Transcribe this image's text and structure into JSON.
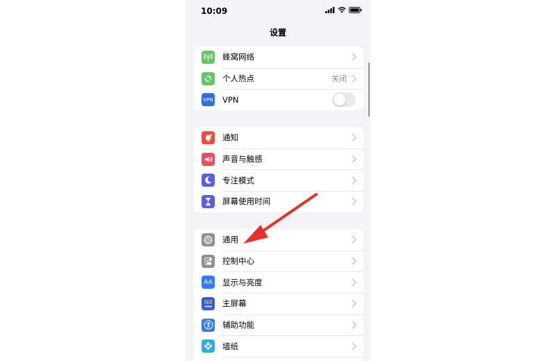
{
  "status_bar": {
    "time": "10:09"
  },
  "nav": {
    "title": "设置"
  },
  "groups": [
    {
      "items": [
        {
          "label": "蜂窝网络",
          "icon": "antenna-icon",
          "color": "#65c466",
          "accessory": "chevron"
        },
        {
          "label": "个人热点",
          "icon": "hotspot-link-icon",
          "color": "#65c466",
          "value": "关闭",
          "accessory": "chevron"
        },
        {
          "label": "VPN",
          "icon": "vpn-icon",
          "icon_text": "VPN",
          "color": "#2f6fe0",
          "accessory": "toggle",
          "toggle_on": false
        }
      ]
    },
    {
      "items": [
        {
          "label": "通知",
          "icon": "notification-bell-icon",
          "color": "#eb4d3d",
          "accessory": "chevron"
        },
        {
          "label": "声音与触感",
          "icon": "speaker-icon",
          "color": "#eb4d62",
          "accessory": "chevron"
        },
        {
          "label": "专注模式",
          "icon": "moon-icon",
          "color": "#5e5ce6",
          "accessory": "chevron"
        },
        {
          "label": "屏幕使用时间",
          "icon": "hourglass-icon",
          "color": "#5e5ce6",
          "accessory": "chevron"
        }
      ]
    },
    {
      "items": [
        {
          "label": "通用",
          "icon": "gear-icon",
          "color": "#8e8e93",
          "accessory": "chevron"
        },
        {
          "label": "控制中心",
          "icon": "switches-icon",
          "color": "#8e8e93",
          "accessory": "chevron"
        },
        {
          "label": "显示与亮度",
          "icon": "text-size-icon",
          "icon_text": "AA",
          "color": "#2f7cf6",
          "accessory": "chevron"
        },
        {
          "label": "主屏幕",
          "icon": "home-screen-grid-icon",
          "color": "#3a5bd1",
          "accessory": "chevron"
        },
        {
          "label": "辅助功能",
          "icon": "accessibility-icon",
          "color": "#2f7cf6",
          "accessory": "chevron"
        },
        {
          "label": "墙纸",
          "icon": "flower-icon",
          "color": "#35aadc",
          "accessory": "chevron"
        }
      ]
    }
  ],
  "annotation": {
    "arrow_color": "#e8302a"
  }
}
